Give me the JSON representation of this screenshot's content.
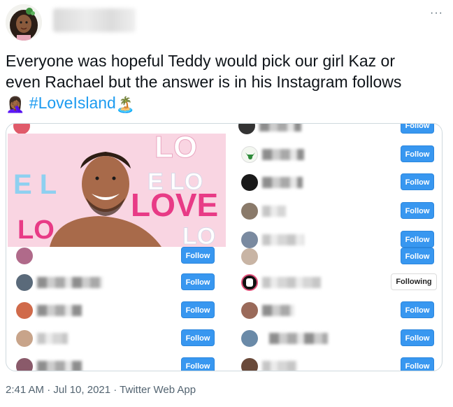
{
  "tweet": {
    "text_line1": "Everyone was hopeful Teddy would pick our girl Kaz or",
    "text_line2": "even Rachael but the answer is in his Instagram follows",
    "emoji_person": "🤦🏾‍♀️",
    "hashtag": "#LoveIsland",
    "emoji_island": "🏝️",
    "timestamp": "2:41 AM · Jul 10, 2021 · Twitter Web App"
  },
  "more_icon": "···",
  "photo_letters": {
    "lo_top": "LO",
    "love_mid": "LOVE",
    "e_lo": "E LO",
    "e_l": "E L",
    "lo_bottom": "LO"
  },
  "follow_list": {
    "left": [
      {
        "button": "Follow"
      },
      {
        "button": "Follow"
      },
      {
        "button": "Follow"
      },
      {
        "button": "Follow"
      },
      {
        "button": "Follow"
      }
    ],
    "right": [
      {
        "button": "Follow"
      },
      {
        "button": "Follow"
      },
      {
        "button": "Follow"
      },
      {
        "button": "Follow"
      },
      {
        "button": "Follow"
      },
      {
        "button": "Following"
      },
      {
        "button": "Follow"
      },
      {
        "button": "Follow"
      },
      {
        "button": "Follow"
      }
    ]
  },
  "colors": {
    "follow_blue": "#3897f0",
    "hashtag_blue": "#1d9bf0",
    "photo_pink": "#f7c6d8"
  }
}
